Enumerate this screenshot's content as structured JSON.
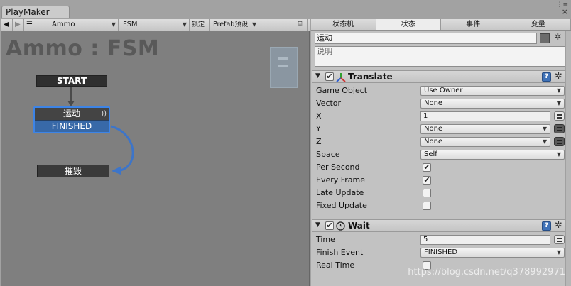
{
  "window": {
    "tab_title": "PlayMaker",
    "controls_glyph": "⋮≡",
    "close_glyph": "×"
  },
  "toolbar": {
    "back": "◀",
    "forward": "▶",
    "menu": "☰",
    "gameobject": "Ammo",
    "fsm": "FSM",
    "lock": "锁定",
    "prefab": "Prefab预设",
    "dropdown_arrow": "▼",
    "icon_glyph": "⌸"
  },
  "graph": {
    "title": "Ammo : FSM",
    "start_node": "START",
    "state_name": "运动",
    "state_wave": "))",
    "state_event": "FINISHED",
    "target_state": "摧毁"
  },
  "inspector": {
    "tabs": [
      "状态机",
      "状态",
      "事件",
      "变量"
    ],
    "active_tab": 1,
    "state_name_value": "运动",
    "description_placeholder": "说明",
    "gear_glyph": "✲",
    "actions": [
      {
        "title": "Translate",
        "enabled_glyph": "✔",
        "collapse_glyph": "▼",
        "help_glyph": "?",
        "fields": {
          "game_object_label": "Game Object",
          "game_object_value": "Use Owner",
          "vector_label": "Vector",
          "vector_value": "None",
          "x_label": "X",
          "x_value": "1",
          "y_label": "Y",
          "y_value": "None",
          "z_label": "Z",
          "z_value": "None",
          "space_label": "Space",
          "space_value": "Self",
          "per_second_label": "Per Second",
          "per_second_checked": "✔",
          "every_frame_label": "Every Frame",
          "every_frame_checked": "✔",
          "late_update_label": "Late Update",
          "late_update_checked": "",
          "fixed_update_label": "Fixed Update",
          "fixed_update_checked": ""
        }
      },
      {
        "title": "Wait",
        "enabled_glyph": "✔",
        "collapse_glyph": "▼",
        "help_glyph": "?",
        "fields": {
          "time_label": "Time",
          "time_value": "5",
          "finish_event_label": "Finish Event",
          "finish_event_value": "FINISHED",
          "real_time_label": "Real Time",
          "real_time_checked": ""
        }
      }
    ]
  },
  "watermark": "https://blog.csdn.net/q378992971",
  "colors": {
    "graph_bg": "#7f7f7f",
    "inspector_bg": "#c2c2c2",
    "selected_border": "#3d84e6",
    "event_bar": "#3869a8",
    "transition_line": "#3d75c9"
  }
}
